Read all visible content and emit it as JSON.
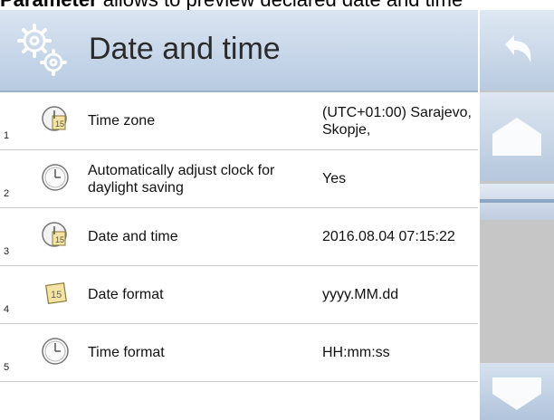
{
  "caption": {
    "bold": "Parameter",
    "rest": " allows to preview declared date and time"
  },
  "header": {
    "title": "Date and time"
  },
  "rows": [
    {
      "num": "1",
      "label": "Time zone",
      "value": "(UTC+01:00) Sarajevo, Skopje,",
      "icon": "calendar-clock-icon"
    },
    {
      "num": "2",
      "label": "Automatically adjust clock for daylight saving",
      "value": "Yes",
      "icon": "clock-icon"
    },
    {
      "num": "3",
      "label": "Date and time",
      "value": "2016.08.04 07:15:22",
      "icon": "calendar-clock-icon"
    },
    {
      "num": "4",
      "label": "Date format",
      "value": "yyyy.MM.dd",
      "icon": "calendar-icon"
    },
    {
      "num": "5",
      "label": "Time format",
      "value": "HH:mm:ss",
      "icon": "clock-icon"
    }
  ],
  "sidebar": {
    "back_icon": "back-arrow-icon",
    "up_icon": "up-arrow-icon",
    "down_icon": "down-arrow-icon"
  }
}
